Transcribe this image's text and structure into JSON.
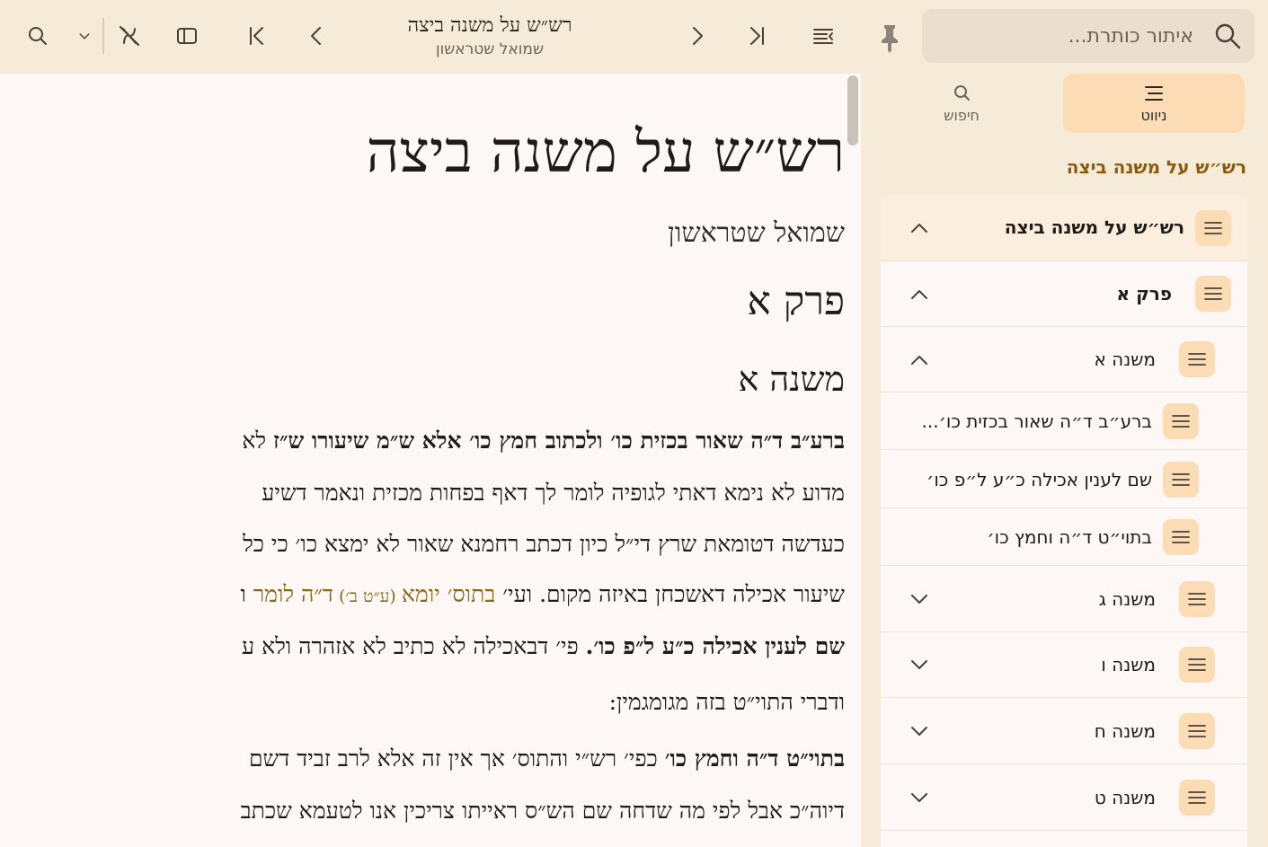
{
  "toolbar": {
    "title": "רש״ש על משנה ביצה",
    "subtitle": "שמואל שטראשון"
  },
  "reader": {
    "book_title": "רש״ש על משנה ביצה",
    "author": "שמואל שטראשון",
    "chapter": "פרק א",
    "mishna": "משנה א",
    "lines": [
      {
        "bold": "ברע״ב ד״ה שאור בכזית כו׳ ולכתוב חמץ כו׳ אלא ש״מ שיעורו ש״ז",
        "rest": " לא"
      },
      {
        "bold": "",
        "rest": "מדוע לא נימא דאתי לגופיה לומר לך דאף בפחות מכזית ונאמר דשיע"
      },
      {
        "bold": "",
        "rest": "כעדשה דטומאת שרץ די״ל כיון דכתב רחמנא שאור לא ימצא כו׳ כי כל"
      },
      {
        "bold": "",
        "rest": "שיעור אכילה דאשכחן באיזה מקום. ועי׳ ",
        "link1": "בתוס׳ יומא",
        "small": " (ע״ט ב׳) ",
        "link2": "ד״ה לומר",
        "tail": " ו"
      },
      {
        "bold": "שם לענין אכילה כ״ע ל״פ כו׳.",
        "rest": " פי׳ דבאכילה לא כתיב לא אזהרה ולא ע"
      },
      {
        "bold": "",
        "rest": "ודברי התוי״ט בזה מגומגמין:"
      },
      {
        "bold": "בתוי״ט ד״ה וחמץ כו׳",
        "rest": " כפי׳ רש״י והתוס׳ אך אין זה אלא לרב זביד דשם"
      },
      {
        "bold": "",
        "rest": "דיוה״כ אבל לפי מה שדחה שם הש״ס ראייתו צריכין אנו לטעמא שכתב"
      }
    ]
  },
  "sidebar": {
    "search_placeholder": "איתור כותרת...",
    "tabs": {
      "navigation": "ניווט",
      "search": "חיפוש"
    },
    "book_title": "רש״ש על משנה ביצה",
    "toc": [
      {
        "label": "רש״ש על משנה ביצה",
        "expanded": true
      },
      {
        "label": "פרק א",
        "expanded": true
      },
      {
        "label": "משנה א",
        "expanded": true
      },
      {
        "label": "ברע״ב ד״ה שאור בכזית כו׳..."
      },
      {
        "label": "שם לענין אכילה כ״ע ל״פ כו׳"
      },
      {
        "label": "בתוי״ט ד״ה וחמץ כו׳"
      },
      {
        "label": "משנה ג",
        "expanded": false
      },
      {
        "label": "משנה ו",
        "expanded": false
      },
      {
        "label": "משנה ח",
        "expanded": false
      },
      {
        "label": "משנה ט",
        "expanded": false
      }
    ]
  },
  "colors": {
    "background": "#f6ead9",
    "reader_bg": "#fdf8f5",
    "accent": "#fbdcb5",
    "link": "#8b6914",
    "nav_title": "#8b5a0e"
  }
}
